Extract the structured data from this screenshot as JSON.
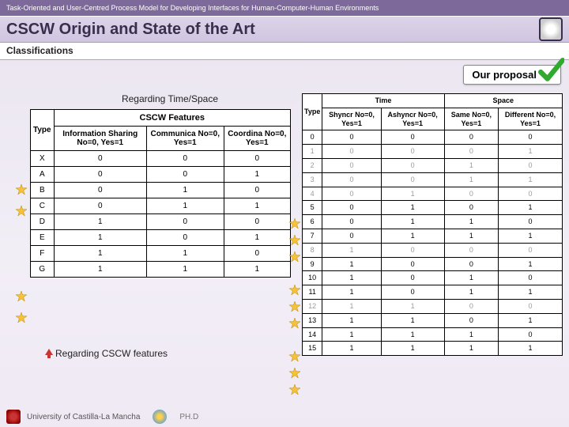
{
  "header": {
    "breadcrumb": "Task-Oriented and User-Centred Process Model for Developing Interfaces for Human-Computer-Human Environments",
    "title": "CSCW Origin and State of the Art",
    "subtitle": "Classifications",
    "proposal": "Our proposal"
  },
  "left": {
    "heading": "Regarding Time/Space",
    "features_label": "CSCW Features",
    "cols": {
      "type": "Type",
      "info": "Information Sharing No=0, Yes=1",
      "comm": "Communica No=0, Yes=1",
      "coord": "Coordina No=0, Yes=1"
    },
    "rows": [
      {
        "type": "X",
        "v": [
          "0",
          "0",
          "0"
        ]
      },
      {
        "type": "A",
        "v": [
          "0",
          "0",
          "1"
        ]
      },
      {
        "type": "B",
        "v": [
          "0",
          "1",
          "0"
        ]
      },
      {
        "type": "C",
        "v": [
          "0",
          "1",
          "1"
        ]
      },
      {
        "type": "D",
        "v": [
          "1",
          "0",
          "0"
        ]
      },
      {
        "type": "E",
        "v": [
          "1",
          "0",
          "1"
        ]
      },
      {
        "type": "F",
        "v": [
          "1",
          "1",
          "0"
        ]
      },
      {
        "type": "G",
        "v": [
          "1",
          "1",
          "1"
        ]
      }
    ],
    "regarding2": "Regarding CSCW features",
    "stars_at": [
      "A",
      "B",
      "F",
      "G"
    ]
  },
  "right": {
    "time": "Time",
    "space": "Space",
    "type": "Type",
    "cols": {
      "syn": "Shyncr No=0, Yes=1",
      "asyn": "Ashyncr No=0, Yes=1",
      "same": "Same No=0, Yes=1",
      "diff": "Different No=0, Yes=1"
    },
    "rows": [
      {
        "t": "0",
        "v": [
          "0",
          "0",
          "0",
          "0"
        ],
        "dim": false
      },
      {
        "t": "1",
        "v": [
          "0",
          "0",
          "0",
          "1"
        ],
        "dim": true
      },
      {
        "t": "2",
        "v": [
          "0",
          "0",
          "1",
          "0"
        ],
        "dim": true
      },
      {
        "t": "3",
        "v": [
          "0",
          "0",
          "1",
          "1"
        ],
        "dim": true
      },
      {
        "t": "4",
        "v": [
          "0",
          "1",
          "0",
          "0"
        ],
        "dim": true
      },
      {
        "t": "5",
        "v": [
          "0",
          "1",
          "0",
          "1"
        ],
        "dim": false
      },
      {
        "t": "6",
        "v": [
          "0",
          "1",
          "1",
          "0"
        ],
        "dim": false
      },
      {
        "t": "7",
        "v": [
          "0",
          "1",
          "1",
          "1"
        ],
        "dim": false
      },
      {
        "t": "8",
        "v": [
          "1",
          "0",
          "0",
          "0"
        ],
        "dim": true
      },
      {
        "t": "9",
        "v": [
          "1",
          "0",
          "0",
          "1"
        ],
        "dim": false
      },
      {
        "t": "10",
        "v": [
          "1",
          "0",
          "1",
          "0"
        ],
        "dim": false
      },
      {
        "t": "11",
        "v": [
          "1",
          "0",
          "1",
          "1"
        ],
        "dim": false
      },
      {
        "t": "12",
        "v": [
          "1",
          "1",
          "0",
          "0"
        ],
        "dim": true
      },
      {
        "t": "13",
        "v": [
          "1",
          "1",
          "0",
          "1"
        ],
        "dim": false
      },
      {
        "t": "14",
        "v": [
          "1",
          "1",
          "1",
          "0"
        ],
        "dim": false
      },
      {
        "t": "15",
        "v": [
          "1",
          "1",
          "1",
          "1"
        ],
        "dim": false
      }
    ],
    "stars_at": [
      "5",
      "6",
      "7",
      "9",
      "10",
      "11",
      "13",
      "14",
      "15"
    ]
  },
  "footer": {
    "university": "University of Castilla-La Mancha",
    "phd": "PH.D"
  }
}
